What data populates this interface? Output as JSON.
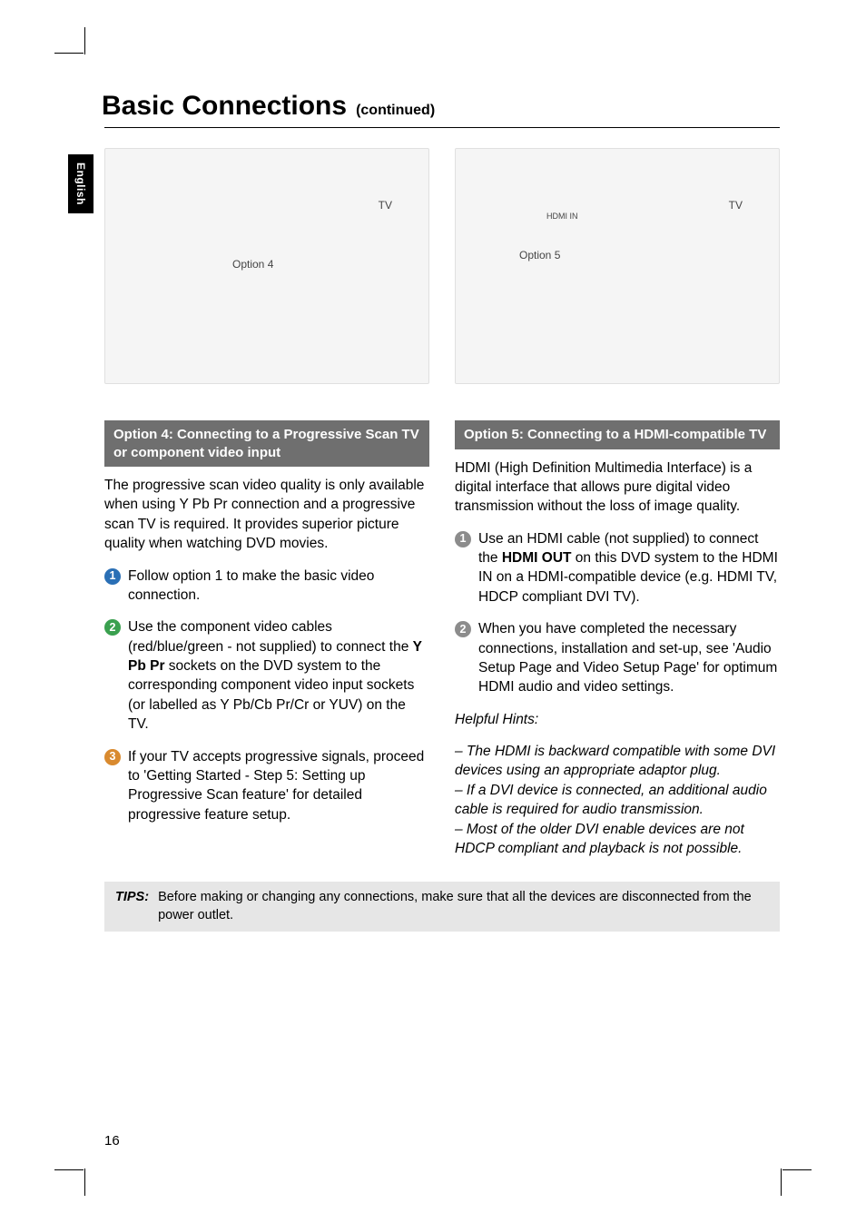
{
  "page": {
    "language_tab": "English",
    "heading": "Basic Connections",
    "continued": "(continued)",
    "page_number": "16"
  },
  "left": {
    "illus": {
      "tv": "TV",
      "option": "Option 4"
    },
    "subhead": "Option 4: Connecting to a Progressive Scan TV or component video input",
    "intro": "The progressive scan video quality is only available when using Y Pb Pr connection and a progressive scan TV is required. It provides superior picture quality when watching DVD movies.",
    "step1": "Follow option 1 to make the basic video connection.",
    "step2_pre": "Use the component video cables (red/blue/green - not supplied) to connect the ",
    "step2_strong": "Y Pb Pr",
    "step2_post": " sockets on the DVD system to the corresponding component video input sockets (or labelled as Y Pb/Cb Pr/Cr or YUV) on the TV.",
    "step3": "If your TV accepts progressive signals, proceed to 'Getting Started - Step 5: Setting up Progressive Scan feature' for detailed progressive feature setup."
  },
  "right": {
    "illus": {
      "tv": "TV",
      "option": "Option 5",
      "hdmi": "HDMI IN"
    },
    "subhead": "Option 5: Connecting to a HDMI-compatible TV",
    "intro": "HDMI (High Definition Multimedia Interface) is a digital interface that allows pure digital video transmission without the loss of image quality.",
    "step1_pre": "Use an HDMI cable (not supplied) to connect the ",
    "step1_strong": "HDMI OUT",
    "step1_post": " on this DVD system to the HDMI IN on a HDMI-compatible device (e.g. HDMI TV, HDCP compliant DVI TV).",
    "step2": "When you have completed the necessary connections, installation and set-up, see 'Audio Setup Page and Video Setup Page' for optimum HDMI audio and video settings.",
    "hints_title": "Helpful Hints:",
    "hint1": "– The HDMI is backward compatible with some DVI devices using an appropriate adaptor plug.",
    "hint2": "– If a DVI device is connected, an additional audio cable is required for audio transmission.",
    "hint3": "– Most of the older DVI enable devices are not HDCP compliant and playback is not possible."
  },
  "tips": {
    "label": "TIPS:",
    "text": "Before making or changing any connections, make sure that all the devices are disconnected from the power outlet."
  }
}
